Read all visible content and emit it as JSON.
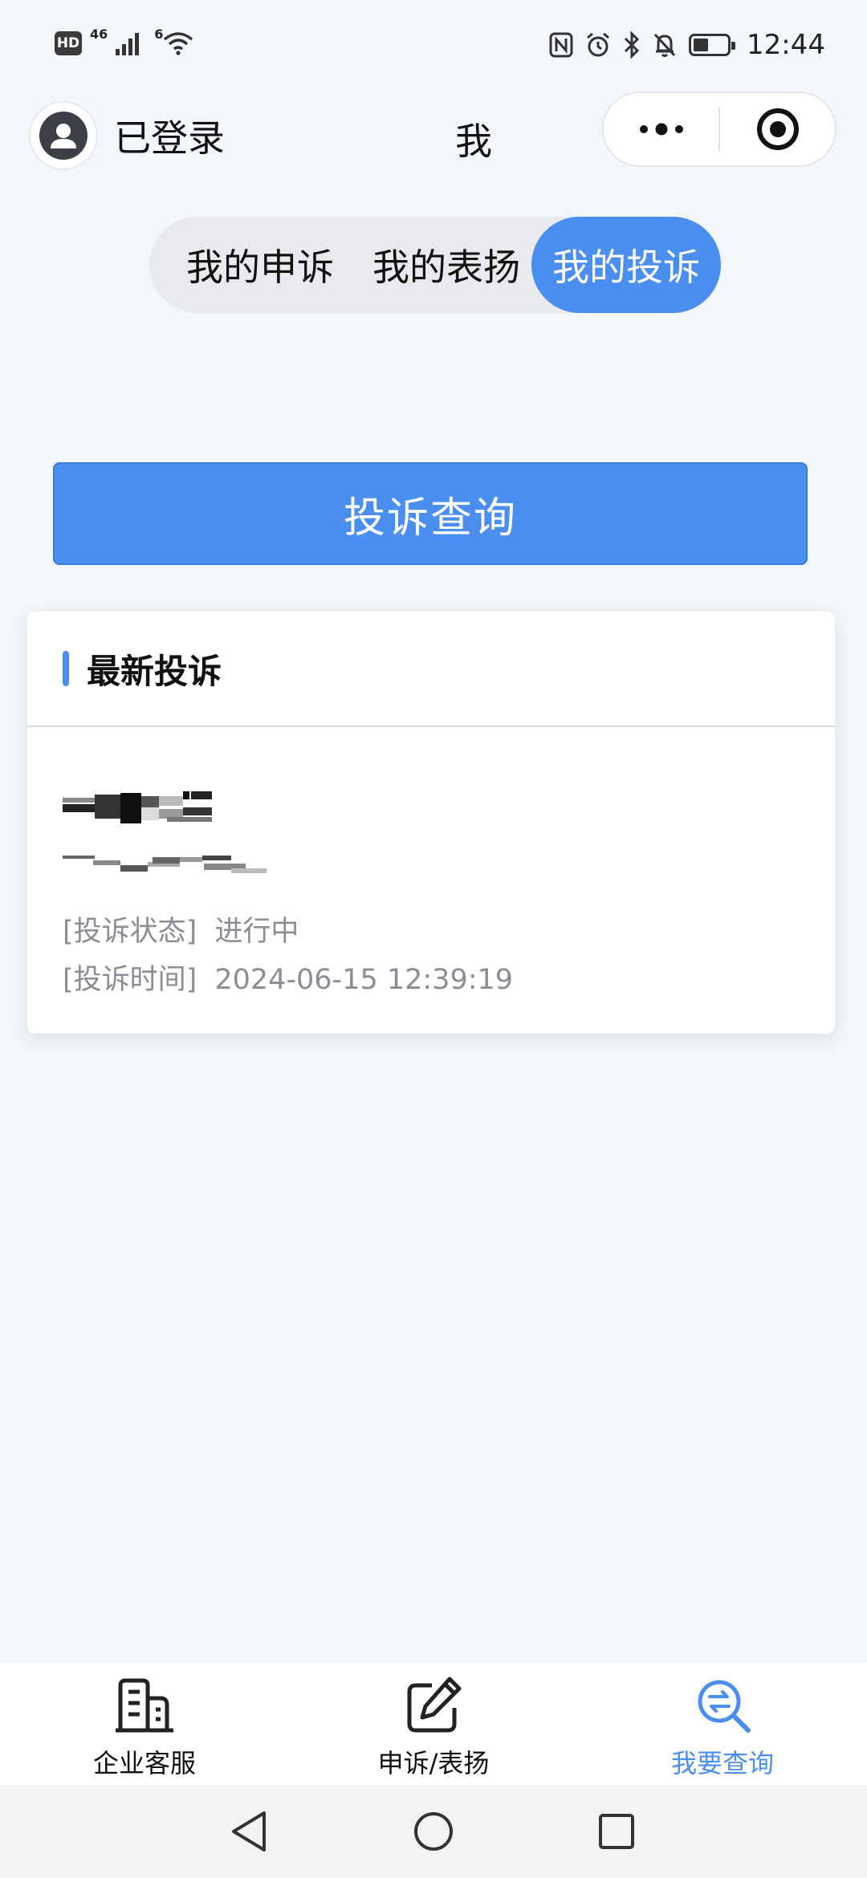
{
  "status_bar": {
    "hd": "HD",
    "network": "46",
    "wifi_badge": "6",
    "battery_level_percent": 45,
    "time": "12:44"
  },
  "header": {
    "user_label": "已登录",
    "title": "我"
  },
  "tabs": [
    {
      "label": "我的申诉",
      "active": false
    },
    {
      "label": "我的表扬",
      "active": false
    },
    {
      "label": "我的投诉",
      "active": true
    }
  ],
  "query_button": "投诉查询",
  "card": {
    "title": "最新投诉",
    "status_label": "[投诉状态]",
    "status_value": "进行中",
    "time_label": "[投诉时间]",
    "time_value": "2024-06-15 12:39:19"
  },
  "tabbar": [
    {
      "label": "企业客服",
      "icon": "building-icon",
      "active": false
    },
    {
      "label": "申诉/表扬",
      "icon": "edit-icon",
      "active": false
    },
    {
      "label": "我要查询",
      "icon": "search-exchange-icon",
      "active": true
    }
  ],
  "colors": {
    "accent": "#4a8ef0",
    "background": "#f3f6fa"
  }
}
